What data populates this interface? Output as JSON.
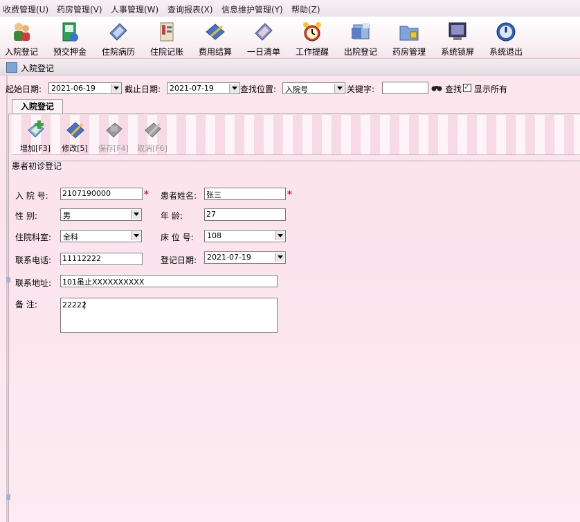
{
  "menu": [
    "收费管理(U)",
    "药房管理(V)",
    "人事管理(W)",
    "查询报表(X)",
    "信息维护管理(Y)",
    "帮助(Z)"
  ],
  "toolbar": [
    {
      "label": "入院登记",
      "icon": "admission-icon"
    },
    {
      "label": "预交押金",
      "icon": "deposit-icon"
    },
    {
      "label": "住院病历",
      "icon": "medical-record-icon"
    },
    {
      "label": "住院记账",
      "icon": "billing-icon"
    },
    {
      "label": "费用结算",
      "icon": "settlement-icon"
    },
    {
      "label": "一日清单",
      "icon": "daily-list-icon"
    },
    {
      "label": "工作提醒",
      "icon": "alarm-clock-icon"
    },
    {
      "label": "出院登记",
      "icon": "discharge-icon"
    },
    {
      "label": "药房管理",
      "icon": "pharmacy-folder-icon"
    },
    {
      "label": "系统锁屏",
      "icon": "monitor-lock-icon"
    },
    {
      "label": "系统退出",
      "icon": "power-icon"
    }
  ],
  "window": {
    "title": "入院登记"
  },
  "filter": {
    "start_label": "起始日期:",
    "start_value": "2021-06-19",
    "end_label": "截止日期:",
    "end_value": "2021-07-19",
    "search_pos_label": "查找位置:",
    "search_pos_value": "入院号",
    "keyword_label": "关键字:",
    "keyword_value": "",
    "find_label": "查找",
    "show_all_label": "显示所有",
    "show_all_checked": true
  },
  "tab": {
    "label": "入院登记"
  },
  "actions": [
    {
      "label": "增加[F3]",
      "enabled": true
    },
    {
      "label": "修改[5]",
      "enabled": true
    },
    {
      "label": "保存[F4]",
      "enabled": false
    },
    {
      "label": "取消[F6]",
      "enabled": false
    }
  ],
  "form": {
    "group_label": "患者初诊登记",
    "admission_no_label": "入 院 号:",
    "admission_no": "2107190000",
    "name_label": "患者姓名:",
    "name": "张三",
    "gender_label": "性    别:",
    "gender": "男",
    "age_label": "年    龄:",
    "age": "27",
    "dept_label": "住院科室:",
    "dept": "全科",
    "bed_label": "床 位 号:",
    "bed": "108",
    "phone_label": "联系电话:",
    "phone": "11112222",
    "reg_date_label": "登记日期:",
    "reg_date": "2021-07-19",
    "address_label": "联系地址:",
    "address": "101虽止XXXXXXXXXX",
    "note_label": "备    注:",
    "note": "22222"
  },
  "colors": {
    "required": "#e02020",
    "check": "#2a55c8"
  }
}
